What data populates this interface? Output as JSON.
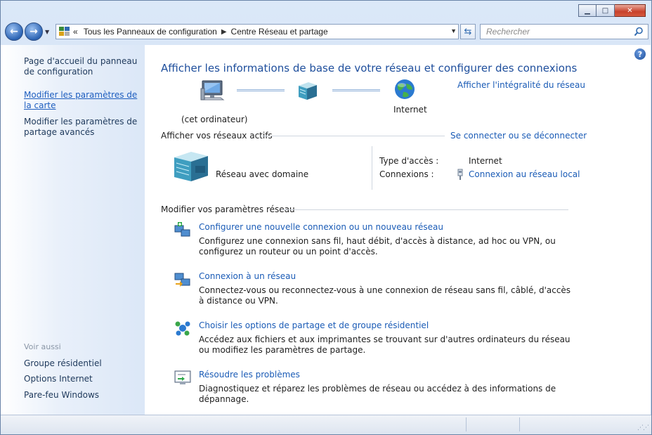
{
  "window": {
    "minimize_glyph": "▁",
    "maximize_glyph": "□",
    "close_glyph": "✕"
  },
  "navbar": {
    "back_glyph": "←",
    "forward_glyph": "→",
    "history_glyph": "▼",
    "breadcrumb_prefix": "«",
    "breadcrumb": [
      "Tous les Panneaux de configuration",
      "Centre Réseau et partage"
    ],
    "breadcrumb_sep": "▶",
    "address_drop": "▼",
    "refresh_glyph": "⇆",
    "search_placeholder": "Rechercher"
  },
  "sidebar": {
    "links": [
      {
        "label": "Page d'accueil du panneau de configuration",
        "active": false
      },
      {
        "label": "Modifier les paramètres de la carte",
        "active": true
      },
      {
        "label": "Modifier les paramètres de partage avancés",
        "active": false
      }
    ],
    "see_also_heading": "Voir aussi",
    "see_also": [
      "Groupe résidentiel",
      "Options Internet",
      "Pare-feu Windows"
    ]
  },
  "main": {
    "help_glyph": "?",
    "title": "Afficher les informations de base de votre réseau et configurer des connexions",
    "map": {
      "computer_label": "(cet ordinateur)",
      "internet_label": "Internet",
      "full_map_link": "Afficher l'intégralité du réseau"
    },
    "active_networks": {
      "heading": "Afficher vos réseaux actifs",
      "connect_link": "Se connecter ou se déconnecter",
      "network_name": "Réseau avec domaine",
      "access_type_label": "Type d'accès :",
      "access_type_value": "Internet",
      "connections_label": "Connexions :",
      "connections_value": "Connexion au réseau local"
    },
    "change_settings": {
      "heading": "Modifier vos paramètres réseau",
      "tasks": [
        {
          "title": "Configurer une nouvelle connexion ou un nouveau réseau",
          "desc": "Configurez une connexion sans fil, haut débit, d'accès à distance, ad hoc ou VPN, ou configurez un routeur ou un point d'accès.",
          "icon": "new-connection-icon"
        },
        {
          "title": "Connexion à un réseau",
          "desc": "Connectez-vous ou reconnectez-vous à une connexion de réseau sans fil, câblé, d'accès à distance ou VPN.",
          "icon": "connect-network-icon"
        },
        {
          "title": "Choisir les options de partage et de groupe résidentiel",
          "desc": "Accédez aux fichiers et aux imprimantes se trouvant sur d'autres ordinateurs du réseau ou modifiez les paramètres de partage.",
          "icon": "homegroup-icon"
        },
        {
          "title": "Résoudre les problèmes",
          "desc": "Diagnostiquez et réparez les problèmes de réseau ou accédez à des informations de dépannage.",
          "icon": "troubleshoot-icon"
        }
      ]
    }
  },
  "colors": {
    "link": "#1a5bb6",
    "title": "#1e4e9c",
    "sidebar_bg": "#dbe7f7",
    "close_button": "#c8412b"
  }
}
